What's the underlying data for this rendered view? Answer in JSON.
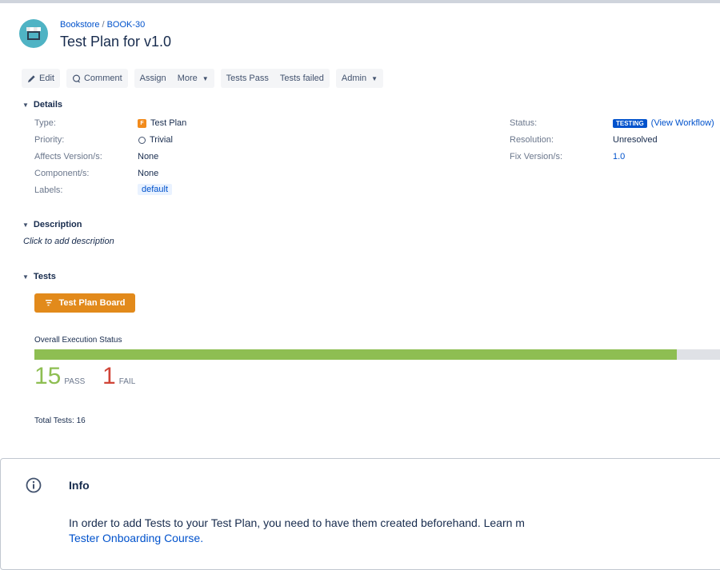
{
  "breadcrumb": {
    "project": "Bookstore",
    "separator": "/",
    "issue_key": "BOOK-30"
  },
  "issue": {
    "title": "Test Plan for v1.0"
  },
  "toolbar": {
    "edit": "Edit",
    "comment": "Comment",
    "assign": "Assign",
    "more": "More",
    "tests_pass": "Tests Pass",
    "tests_failed": "Tests failed",
    "admin": "Admin"
  },
  "sections": {
    "details": "Details",
    "description": "Description",
    "tests": "Tests"
  },
  "details": {
    "type_label": "Type:",
    "type_value": "Test Plan",
    "priority_label": "Priority:",
    "priority_value": "Trivial",
    "affects_label": "Affects Version/s:",
    "affects_value": "None",
    "component_label": "Component/s:",
    "component_value": "None",
    "labels_label": "Labels:",
    "labels_value": "default",
    "status_label": "Status:",
    "status_value": "TESTING",
    "status_link": "(View Workflow)",
    "resolution_label": "Resolution:",
    "resolution_value": "Unresolved",
    "fixversion_label": "Fix Version/s:",
    "fixversion_value": "1.0"
  },
  "description": {
    "placeholder": "Click to add description"
  },
  "tests": {
    "board_button": "Test Plan Board",
    "exec_title": "Overall Execution Status",
    "pass_fraction": 0.9375,
    "pass_count": "15",
    "pass_label": "PASS",
    "fail_count": "1",
    "fail_label": "FAIL",
    "total": "Total Tests: 16"
  },
  "info": {
    "title": "Info",
    "text": "In order to add Tests to your Test Plan, you need to have them created beforehand. Learn m",
    "link": "Tester Onboarding Course."
  },
  "colors": {
    "link": "#0052cc",
    "pass": "#8ebe52",
    "fail": "#d04437",
    "board_button": "#e28a1b",
    "status_lozenge": "#0052cc"
  }
}
